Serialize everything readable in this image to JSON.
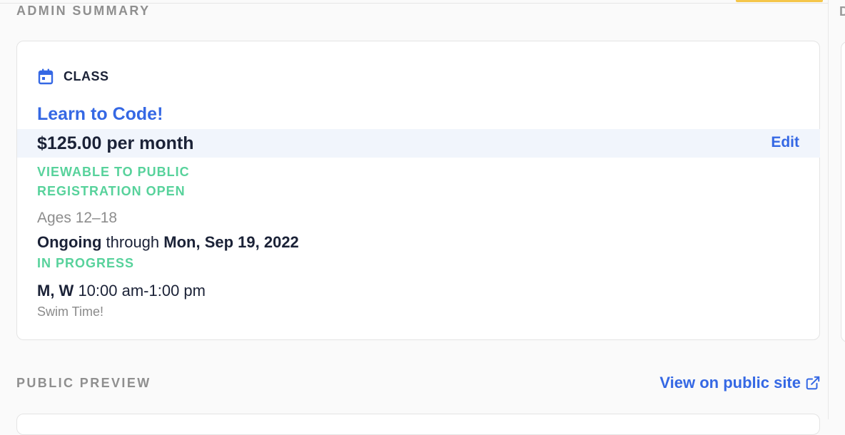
{
  "sections": {
    "admin_summary": "ADMIN SUMMARY",
    "public_preview": "PUBLIC PREVIEW",
    "right_partial": "D"
  },
  "listing": {
    "type_icon": "calendar-icon",
    "type_label": "CLASS",
    "title": "Learn to Code!",
    "price": "$125.00 per month",
    "edit_label": "Edit",
    "visibility_status": "VIEWABLE TO PUBLIC",
    "registration_status": "REGISTRATION OPEN",
    "ages": "Ages 12–18",
    "date_start": "Ongoing",
    "date_connector": " through ",
    "date_end": "Mon, Sep 19, 2022",
    "progress_status": "IN PROGRESS",
    "schedule_days": "M, W",
    "schedule_time": " 10:00 am-1:00 pm",
    "note": "Swim Time!"
  },
  "preview": {
    "view_link": "View on public site",
    "link_icon": "external-link-icon"
  },
  "colors": {
    "accent_blue": "#3568e4",
    "status_green": "#57d29b",
    "heading_gray": "#8f8f8f",
    "highlight_row": "#f1f5fc",
    "top_accent": "#f5c64a"
  }
}
